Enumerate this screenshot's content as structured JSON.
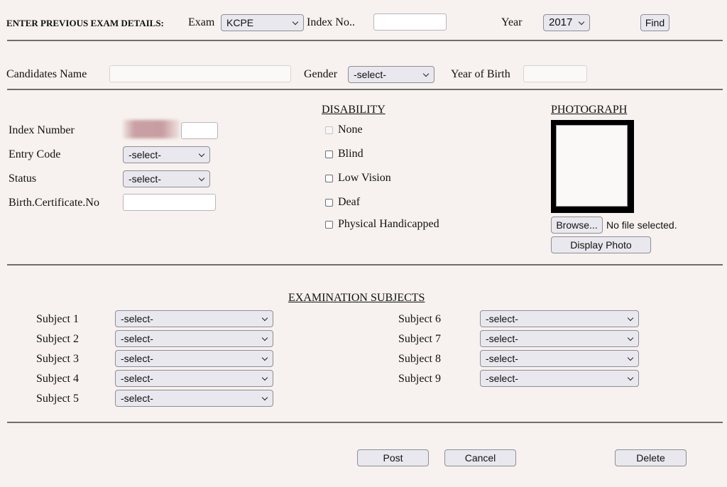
{
  "previous_exam": {
    "heading": "ENTER PREVIOUS EXAM DETAILS:",
    "exam_label": "Exam",
    "exam_value": "KCPE",
    "index_label": "Index No..",
    "index_value": "",
    "year_label": "Year",
    "year_value": "2017",
    "find_button": "Find"
  },
  "candidate": {
    "name_label": "Candidates Name",
    "name_value": "",
    "gender_label": "Gender",
    "gender_value": "-select-",
    "yob_label": "Year of Birth",
    "yob_value": ""
  },
  "details": {
    "index_number_label": "Index Number",
    "index_number_suffix": "",
    "entry_code_label": "Entry Code",
    "entry_code_value": "-select-",
    "status_label": "Status",
    "status_value": "-select-",
    "birth_cert_label": "Birth.Certificate.No",
    "birth_cert_value": ""
  },
  "disability": {
    "heading": "DISABILITY",
    "options": [
      {
        "label": "None",
        "checked": false,
        "disabled": true
      },
      {
        "label": "Blind",
        "checked": false,
        "disabled": false
      },
      {
        "label": "Low Vision",
        "checked": false,
        "disabled": false
      },
      {
        "label": "Deaf",
        "checked": false,
        "disabled": false
      },
      {
        "label": "Physical Handicapped",
        "checked": false,
        "disabled": false
      }
    ]
  },
  "photograph": {
    "heading": "PHOTOGRAPH",
    "browse_button": "Browse...",
    "file_status": "No file selected.",
    "display_button": "Display Photo"
  },
  "subjects": {
    "heading": "EXAMINATION SUBJECTS",
    "items": [
      {
        "label": "Subject 1",
        "value": "-select-"
      },
      {
        "label": "Subject 2",
        "value": "-select-"
      },
      {
        "label": "Subject 3",
        "value": "-select-"
      },
      {
        "label": "Subject 4",
        "value": "-select-"
      },
      {
        "label": "Subject 5",
        "value": "-select-"
      },
      {
        "label": "Subject 6",
        "value": "-select-"
      },
      {
        "label": "Subject 7",
        "value": "-select-"
      },
      {
        "label": "Subject 8",
        "value": "-select-"
      },
      {
        "label": "Subject 9",
        "value": "-select-"
      }
    ]
  },
  "actions": {
    "post": "Post",
    "cancel": "Cancel",
    "delete": "Delete"
  }
}
